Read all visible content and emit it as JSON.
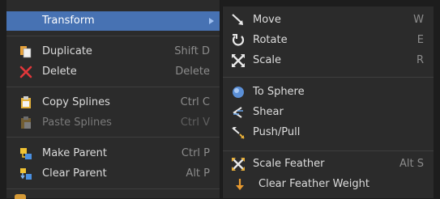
{
  "left_menu": {
    "items": [
      {
        "label": "Transform",
        "shortcut": "",
        "icon": "none",
        "submenu": true,
        "highlighted": true
      },
      {
        "label": "Duplicate",
        "shortcut": "Shift D",
        "icon": "duplicate-icon"
      },
      {
        "label": "Delete",
        "shortcut": "Delete",
        "icon": "delete-x-icon"
      },
      {
        "label": "Copy Splines",
        "shortcut": "Ctrl C",
        "icon": "copy-clipboard-icon"
      },
      {
        "label": "Paste Splines",
        "shortcut": "Ctrl V",
        "icon": "paste-clipboard-icon",
        "disabled": true
      },
      {
        "label": "Make Parent",
        "shortcut": "Ctrl P",
        "icon": "make-parent-icon"
      },
      {
        "label": "Clear Parent",
        "shortcut": "Alt P",
        "icon": "clear-parent-icon"
      }
    ]
  },
  "right_menu": {
    "items": [
      {
        "label": "Move",
        "shortcut": "W",
        "icon": "move-arrow-icon"
      },
      {
        "label": "Rotate",
        "shortcut": "E",
        "icon": "rotate-icon"
      },
      {
        "label": "Scale",
        "shortcut": "R",
        "icon": "scale-icon"
      },
      {
        "label": "To Sphere",
        "shortcut": "",
        "icon": "sphere-icon"
      },
      {
        "label": "Shear",
        "shortcut": "",
        "icon": "shear-icon"
      },
      {
        "label": "Push/Pull",
        "shortcut": "",
        "icon": "push-pull-icon"
      },
      {
        "label": "Scale Feather",
        "shortcut": "Alt S",
        "icon": "scale-feather-icon"
      },
      {
        "label": "Clear Feather Weight",
        "shortcut": "",
        "icon": "clear-feather-arrow-icon"
      }
    ]
  },
  "colors": {
    "highlight": "#4772b3",
    "menu_bg": "#2b2b2b"
  }
}
